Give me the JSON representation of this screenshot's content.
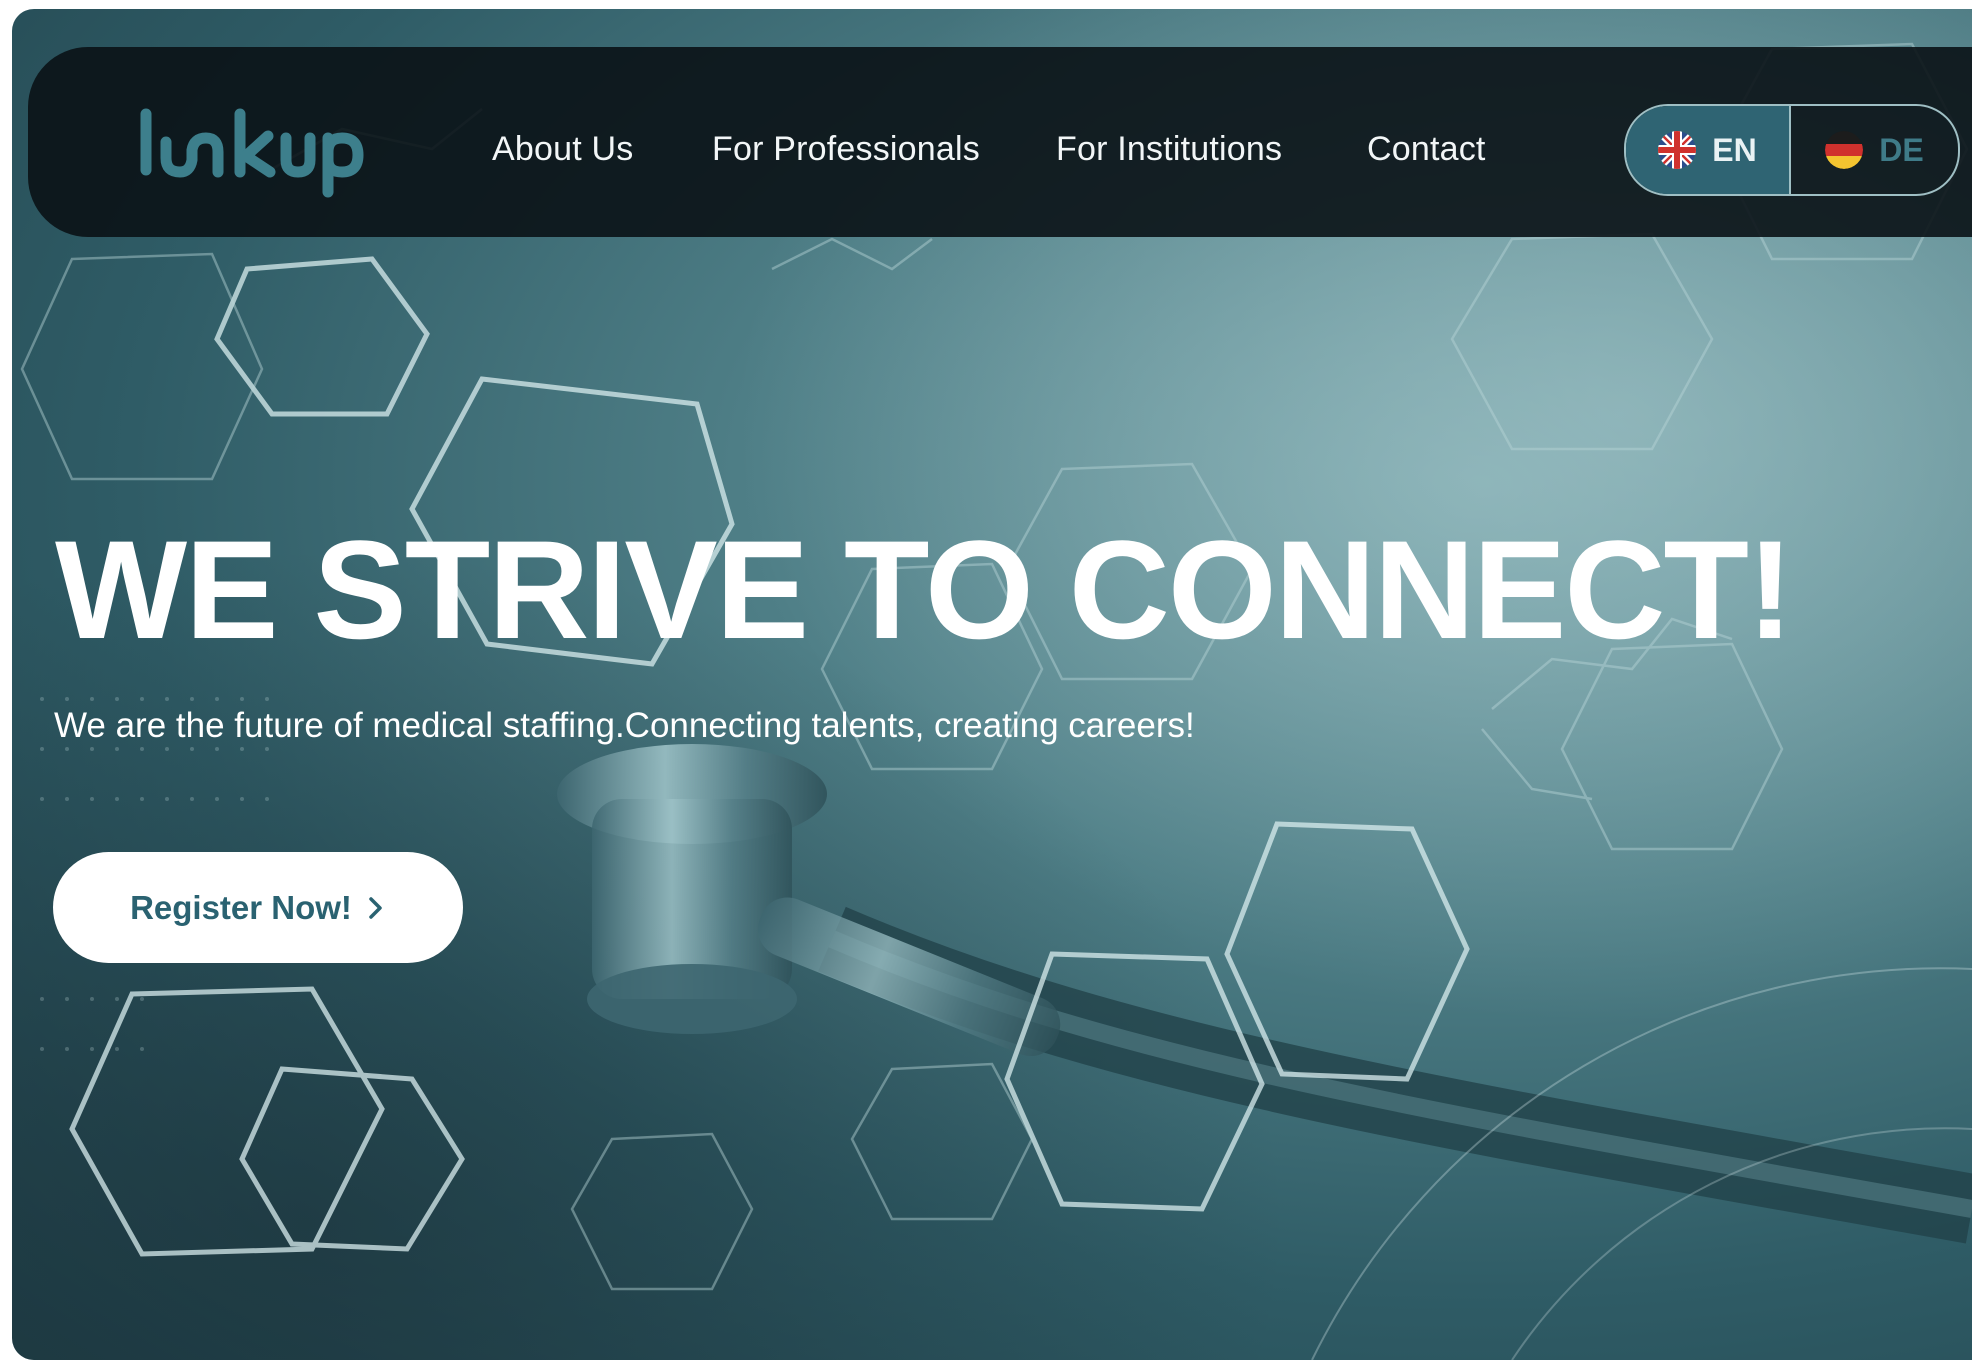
{
  "brand": {
    "logo_text": "linkup",
    "accent_color": "#3d7f8c",
    "button_text_color": "#2a6271"
  },
  "nav": {
    "items": [
      {
        "label": "About Us"
      },
      {
        "label": "For Professionals"
      },
      {
        "label": "For Institutions"
      },
      {
        "label": "Contact"
      }
    ]
  },
  "language": {
    "options": [
      {
        "code": "EN",
        "icon": "uk-flag-icon",
        "active": true
      },
      {
        "code": "DE",
        "icon": "germany-flag-icon",
        "active": false
      }
    ]
  },
  "hero": {
    "title": "WE STRIVE TO CONNECT!",
    "subtitle": "We are the future of medical staffing.Connecting talents, creating careers!",
    "cta_label": "Register Now!",
    "cta_icon": "chevron-right-icon"
  }
}
